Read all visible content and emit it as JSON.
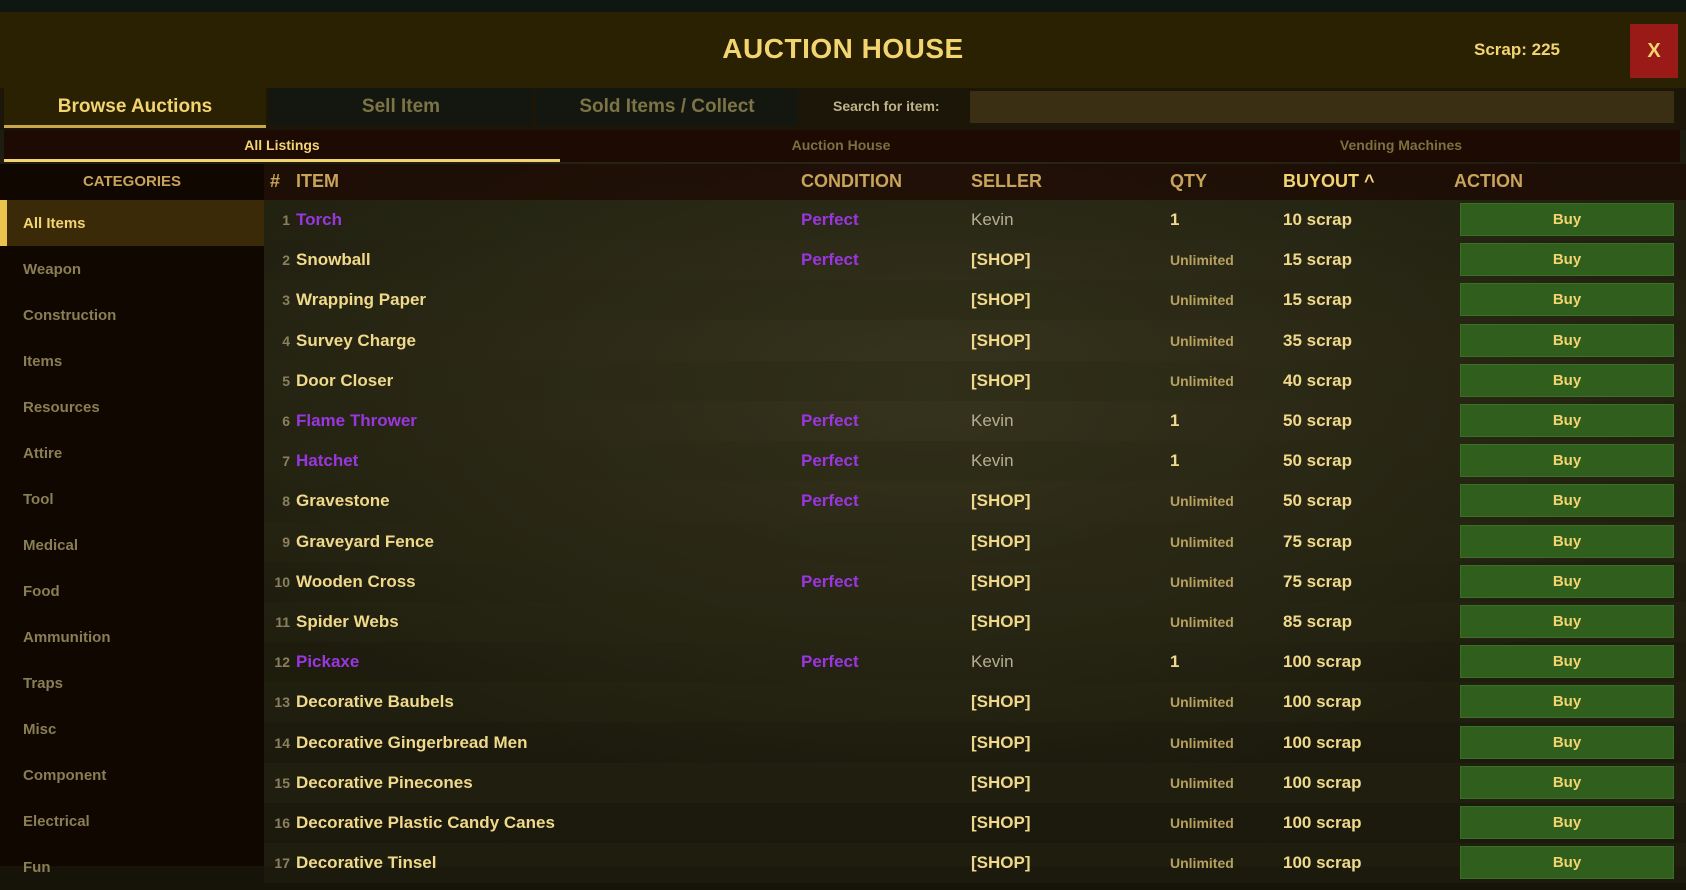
{
  "header": {
    "title": "AUCTION HOUSE",
    "scrap": "Scrap: 225",
    "close_label": "X"
  },
  "tabs": [
    {
      "label": "Browse Auctions",
      "active": true
    },
    {
      "label": "Sell Item",
      "active": false
    },
    {
      "label": "Sold Items / Collect",
      "active": false
    }
  ],
  "search": {
    "label": "Search for item:",
    "value": ""
  },
  "subtabs": [
    {
      "label": "All Listings",
      "active": true
    },
    {
      "label": "Auction House",
      "active": false
    },
    {
      "label": "Vending Machines",
      "active": false
    }
  ],
  "sidebar": {
    "title": "CATEGORIES",
    "items": [
      "All Items",
      "Weapon",
      "Construction",
      "Items",
      "Resources",
      "Attire",
      "Tool",
      "Medical",
      "Food",
      "Ammunition",
      "Traps",
      "Misc",
      "Component",
      "Electrical",
      "Fun"
    ],
    "active_index": 0
  },
  "table": {
    "headers": {
      "num": "#",
      "item": "ITEM",
      "condition": "CONDITION",
      "seller": "SELLER",
      "qty": "QTY",
      "buyout": "BUYOUT ^",
      "action": "ACTION"
    },
    "buy_label": "Buy",
    "rows": [
      {
        "n": "1",
        "item": "Torch",
        "condition": "Perfect",
        "seller": "Kevin",
        "qty": "1",
        "price": "10 scrap"
      },
      {
        "n": "2",
        "item": "Snowball",
        "condition": "Perfect",
        "seller": "[SHOP]",
        "qty": "Unlimited",
        "price": "15 scrap"
      },
      {
        "n": "3",
        "item": "Wrapping Paper",
        "condition": "",
        "seller": "[SHOP]",
        "qty": "Unlimited",
        "price": "15 scrap"
      },
      {
        "n": "4",
        "item": "Survey Charge",
        "condition": "",
        "seller": "[SHOP]",
        "qty": "Unlimited",
        "price": "35 scrap"
      },
      {
        "n": "5",
        "item": "Door Closer",
        "condition": "",
        "seller": "[SHOP]",
        "qty": "Unlimited",
        "price": "40 scrap"
      },
      {
        "n": "6",
        "item": "Flame Thrower",
        "condition": "Perfect",
        "seller": "Kevin",
        "qty": "1",
        "price": "50 scrap"
      },
      {
        "n": "7",
        "item": "Hatchet",
        "condition": "Perfect",
        "seller": "Kevin",
        "qty": "1",
        "price": "50 scrap"
      },
      {
        "n": "8",
        "item": "Gravestone",
        "condition": "Perfect",
        "seller": "[SHOP]",
        "qty": "Unlimited",
        "price": "50 scrap"
      },
      {
        "n": "9",
        "item": "Graveyard Fence",
        "condition": "",
        "seller": "[SHOP]",
        "qty": "Unlimited",
        "price": "75 scrap"
      },
      {
        "n": "10",
        "item": "Wooden Cross",
        "condition": "Perfect",
        "seller": "[SHOP]",
        "qty": "Unlimited",
        "price": "75 scrap"
      },
      {
        "n": "11",
        "item": "Spider Webs",
        "condition": "",
        "seller": "[SHOP]",
        "qty": "Unlimited",
        "price": "85 scrap"
      },
      {
        "n": "12",
        "item": "Pickaxe",
        "condition": "Perfect",
        "seller": "Kevin",
        "qty": "1",
        "price": "100 scrap"
      },
      {
        "n": "13",
        "item": "Decorative Baubels",
        "condition": "",
        "seller": "[SHOP]",
        "qty": "Unlimited",
        "price": "100 scrap"
      },
      {
        "n": "14",
        "item": "Decorative Gingerbread Men",
        "condition": "",
        "seller": "[SHOP]",
        "qty": "Unlimited",
        "price": "100 scrap"
      },
      {
        "n": "15",
        "item": "Decorative Pinecones",
        "condition": "",
        "seller": "[SHOP]",
        "qty": "Unlimited",
        "price": "100 scrap"
      },
      {
        "n": "16",
        "item": "Decorative Plastic Candy Canes",
        "condition": "",
        "seller": "[SHOP]",
        "qty": "Unlimited",
        "price": "100 scrap"
      },
      {
        "n": "17",
        "item": "Decorative Tinsel",
        "condition": "",
        "seller": "[SHOP]",
        "qty": "Unlimited",
        "price": "100 scrap"
      }
    ]
  },
  "colors": {
    "accent": "#f2d470",
    "perfect": "#9a36e0",
    "buy_bg": "#2f5e1d",
    "close_bg": "#9a1a18"
  }
}
